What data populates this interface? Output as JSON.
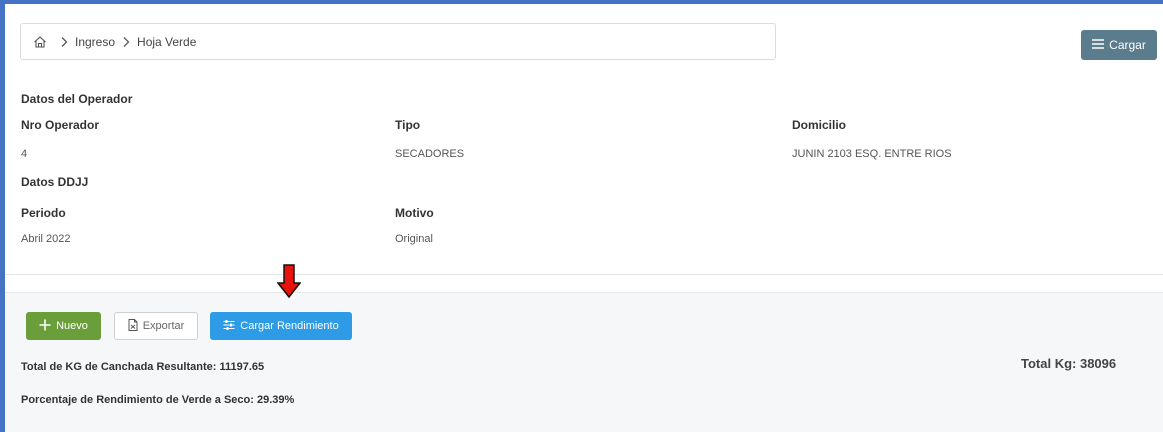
{
  "breadcrumb": {
    "items": [
      "Ingreso",
      "Hoja Verde"
    ]
  },
  "toolbar": {
    "cargar_label": "Cargar"
  },
  "operador": {
    "section_title": "Datos del Operador",
    "nro_label": "Nro Operador",
    "nro_value": "4",
    "tipo_label": "Tipo",
    "tipo_value": "SECADORES",
    "domicilio_label": "Domicilio",
    "domicilio_value": "JUNIN 2103 ESQ. ENTRE RIOS"
  },
  "ddjj": {
    "section_title": "Datos DDJJ",
    "periodo_label": "Periodo",
    "periodo_value": "Abril 2022",
    "motivo_label": "Motivo",
    "motivo_value": "Original"
  },
  "actions": {
    "nuevo_label": "Nuevo",
    "exportar_label": "Exportar",
    "rendimiento_label": "Cargar Rendimiento"
  },
  "summary": {
    "canchada_text": "Total de KG de Canchada Resultante: 11197.65",
    "porcentaje_text": "Porcentaje de Rendimiento de Verde a Seco: 29.39%",
    "total_kg_text": "Total Kg: 38096"
  },
  "colors": {
    "frame": "#4472c4",
    "cargar_button": "#5b7c8d",
    "nuevo_button": "#6a9e3a",
    "rendimiento_button": "#2d9be5",
    "annotation_arrow": "#e8120c"
  },
  "icons": {
    "home": "home-icon",
    "separator": "chevron-right-icon",
    "cargar": "menu-icon",
    "nuevo": "plus-icon",
    "exportar": "document-icon",
    "rendimiento": "sliders-icon",
    "annotation": "down-arrow-icon"
  }
}
